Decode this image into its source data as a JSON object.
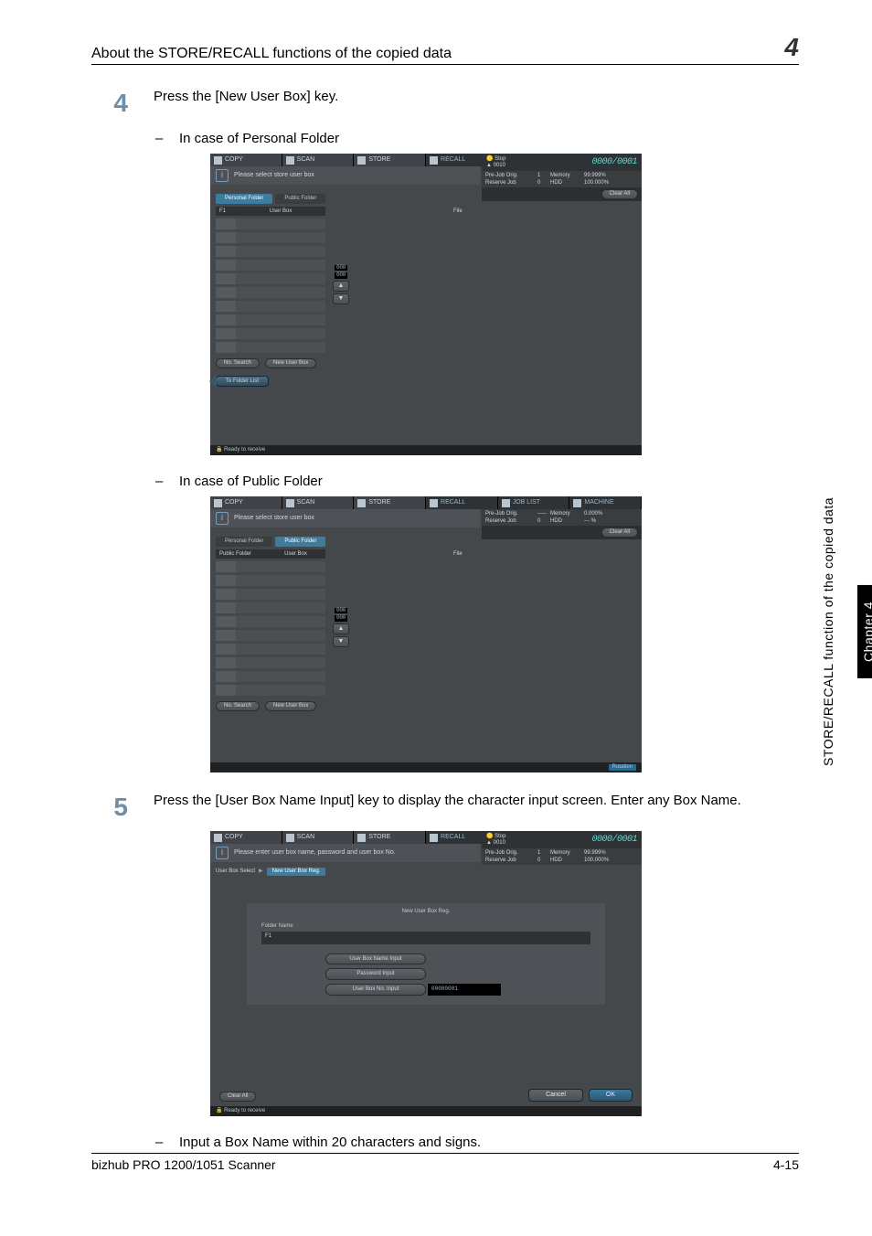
{
  "page": {
    "header_title": "About the STORE/RECALL functions of the copied data",
    "chapter_num": "4",
    "side_chapter": "Chapter 4",
    "side_section": "STORE/RECALL function of the copied data",
    "footer_left": "bizhub PRO 1200/1051 Scanner",
    "footer_right": "4-15"
  },
  "steps": {
    "s4_num": "4",
    "s4_text": "Press the [New User Box] key.",
    "s4_sub1": "In case of Personal Folder",
    "s4_sub2": "In case of Public Folder",
    "s5_num": "5",
    "s5_text": "Press the [User Box Name Input] key to display the character input screen. Enter any Box Name.",
    "s5_sub1": "Input a Box Name within 20 characters and signs."
  },
  "shot_common": {
    "tab_copy": "COPY",
    "tab_scan": "SCAN",
    "tab_store": "STORE",
    "tab_recall": "RECALL",
    "tab_joblist": "JOB LIST",
    "tab_machine": "MACHINE",
    "msg_select": "Please select store user box",
    "status_stop": "Stop",
    "status_code": "0010",
    "counter": "0000/0001",
    "grid_preorig": "Pre-Job Orig.",
    "grid_reserve": "Reserve Job",
    "grid_memory": "Memory",
    "grid_hdd": "HDD",
    "val_1": "1",
    "val_0": "0",
    "pct_99": "99.999%",
    "pct_100": "100.000%",
    "pct_0": "0.000%",
    "val_dash": "-----",
    "val_pctdash": "--- %",
    "btn_clearall": "Clear All",
    "col_userbox": "User Box",
    "col_file": "File",
    "pager_top": "000",
    "pager_bot": "000",
    "f1": "F1",
    "btn_nosearch": "No. Search",
    "btn_newbox": "New User Box",
    "btn_tofolder": "To Folder List",
    "status_ready": "Ready to receive",
    "status_rotation": "Rotation"
  },
  "shot1": {
    "ftab_personal": "Personal Folder",
    "ftab_public": "Public Folder"
  },
  "shot2": {
    "col_label": "Public Folder"
  },
  "shot3": {
    "msg": "Please enter user box name, password and user box No.",
    "crumb1": "User Box Select",
    "crumb2": "New User Box Reg.",
    "panel_title": "New User Box Reg.",
    "folder_name": "Folder Name",
    "btn_name_input": "User Box Name Input",
    "btn_pw_input": "Password Input",
    "btn_no_input": "User Box No. Input",
    "boxno_val": "00000001",
    "btn_cancel": "Cancel",
    "btn_ok": "OK"
  }
}
